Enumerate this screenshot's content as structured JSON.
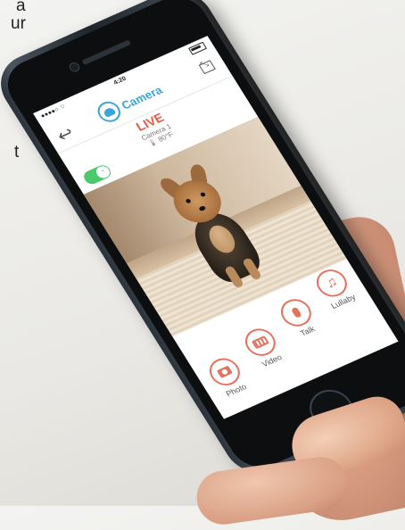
{
  "background_text": {
    "line1": "a",
    "line2": "ur",
    "line3": "t"
  },
  "status_bar": {
    "carrier": "●●●●○ ⌔",
    "time": "4:20"
  },
  "header": {
    "back_icon": "back-arrow-icon",
    "logo_text": "Camera",
    "expand_icon": "expand-icon"
  },
  "live": {
    "label": "LIVE",
    "camera_name": "Camera 1",
    "temperature": "🌡 80°F"
  },
  "toggle": {
    "state": "on",
    "knob_glyph": "◔"
  },
  "actions": [
    {
      "label": "Photo",
      "icon": "camera-icon"
    },
    {
      "label": "Video",
      "icon": "video-icon"
    },
    {
      "label": "Talk",
      "icon": "microphone-icon"
    },
    {
      "label": "Lullaby",
      "icon": "music-note-icon"
    }
  ],
  "colors": {
    "accent_blue": "#3aa6d8",
    "accent_red": "#e25a45",
    "action_orange": "#e4735e",
    "toggle_green": "#4cc86d"
  }
}
